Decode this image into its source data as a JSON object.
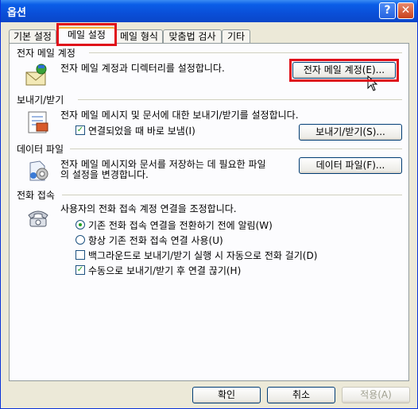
{
  "window": {
    "title": "옵션",
    "help_glyph": "?",
    "close_glyph": "✕"
  },
  "tabs": [
    {
      "label": "기본 설정"
    },
    {
      "label": "메일 설정"
    },
    {
      "label": "메일 형식"
    },
    {
      "label": "맞춤법 검사"
    },
    {
      "label": "기타"
    }
  ],
  "accounts": {
    "header": "전자 메일 계정",
    "description": "전자 메일 계정과 디렉터리를 설정합니다.",
    "button_label": "전자 메일 계정(E)..."
  },
  "send_receive": {
    "header": "보내기/받기",
    "description": "전자 메일 메시지 및 문서에 대한 보내기/받기를 설정합니다.",
    "checkbox_label": "연결되었을 때 바로 보냄(I)",
    "button_label": "보내기/받기(S)..."
  },
  "data_files": {
    "header": "데이터 파일",
    "description_line1": "전자 메일 메시지와 문서를 저장하는 데 필요한 파일",
    "description_line2": "의 설정을 변경합니다.",
    "button_label": "데이터 파일(F)..."
  },
  "dialup": {
    "header": "전화 접속",
    "description": "사용자의 전화 접속 계정 연결을 조정합니다.",
    "options": [
      {
        "label": "기존 전화 접속 연결을 전환하기 전에 알림(W)",
        "type": "radio",
        "checked": true
      },
      {
        "label": "항상 기존 전화 접속 연결 사용(U)",
        "type": "radio",
        "checked": false
      },
      {
        "label": "백그라운드로 보내기/받기 실행 시 자동으로 전화 걸기(D)",
        "type": "checkbox",
        "checked": false
      },
      {
        "label": "수동으로 보내기/받기 후 연결 끊기(H)",
        "type": "checkbox",
        "checked": true
      }
    ]
  },
  "footer": {
    "ok_label": "확인",
    "cancel_label": "취소",
    "apply_label": "적용(A)"
  },
  "colors": {
    "titlebar": "#0a4fd8",
    "highlight": "#e0101a",
    "face": "#ece9d8",
    "check": "#21a121"
  }
}
